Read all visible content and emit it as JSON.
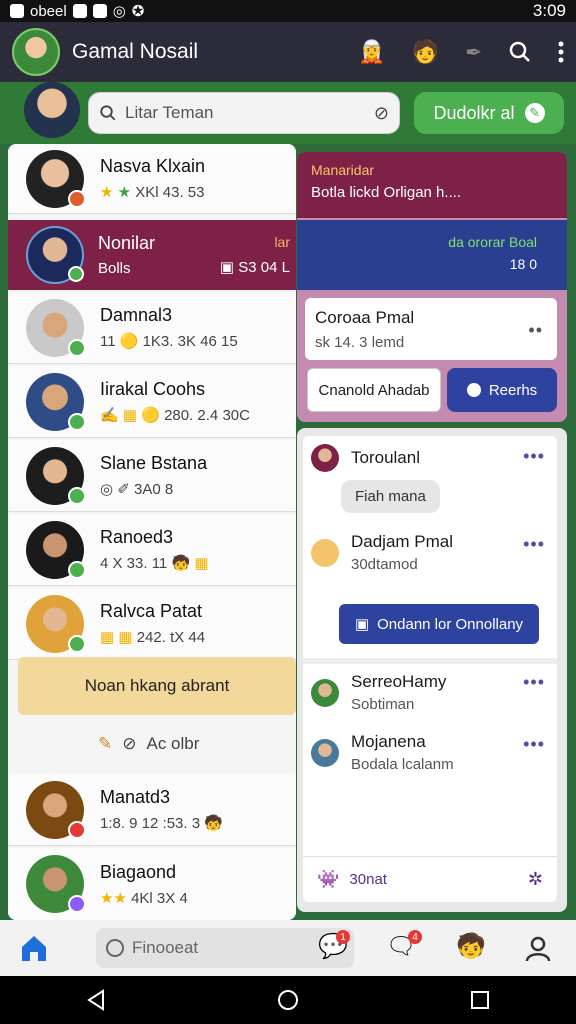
{
  "status_bar": {
    "left_text": "obeel",
    "time": "3:09"
  },
  "app_bar": {
    "title": "Gamal Nosail"
  },
  "search": {
    "placeholder": "Litar Teman",
    "button_label": "Dudolkr al"
  },
  "contacts_top": {
    "name": "Nasva Klxain",
    "meta": "XKl 43. 53"
  },
  "group": {
    "name": "Nonilar",
    "meta": "Bolls",
    "right_top": "lar",
    "right_bottom": "S3 04 L"
  },
  "contacts": [
    {
      "name": "Damnal3",
      "meta": "11 🟡 1K3. 3K 46 15"
    },
    {
      "name": "Iirakal Coohs",
      "meta": "🟡 280. 2.4 30C"
    },
    {
      "name": "Slane Bstana",
      "meta": "3A0 8"
    },
    {
      "name": "Ranoed3",
      "meta": "4 X 33. 11"
    },
    {
      "name": "Ralvca Patat",
      "meta": "242. tX 44"
    }
  ],
  "banner": {
    "text": "Noan hkang abrant"
  },
  "small_row": {
    "text": "Ac olbr"
  },
  "contacts_bottom": [
    {
      "name": "Manatd3",
      "meta": "1:8. 9 12 :53. 3"
    },
    {
      "name": "Biagaond",
      "meta": "4Kl 3X 4"
    }
  ],
  "message_card": {
    "top_line1": "Manaridar",
    "top_line2": "Botla lickd Orligan h....",
    "blue_line1": "da ororar Boal",
    "blue_line2": "18 0",
    "detail_title": "Coroaa Pmal",
    "detail_sub": "sk 14. 3 lemd",
    "btn_secondary": "Cnanold Ahadab",
    "btn_primary": "Reerhs"
  },
  "chat_list": {
    "item1_title": "Toroulanl",
    "item1_chip": "Fiah mana",
    "item2_title": "Dadjam Pmal",
    "item2_sub": "30dtamod",
    "blue_button": "Ondann lor Onnollany",
    "item3_title": "SerreoHamy",
    "item3_sub": "Sobtiman",
    "item4_title": "Mojanena",
    "item4_sub": "Bodala lcalanm",
    "footer": "30nat"
  },
  "bottom_nav": {
    "search_placeholder": "Finooeat",
    "badge1": "1",
    "badge2": "4"
  },
  "colors": {
    "maroon": "#7e2146",
    "navy": "#2a3f8f",
    "green": "#4caf50",
    "dark_header": "#2b2b3a"
  }
}
